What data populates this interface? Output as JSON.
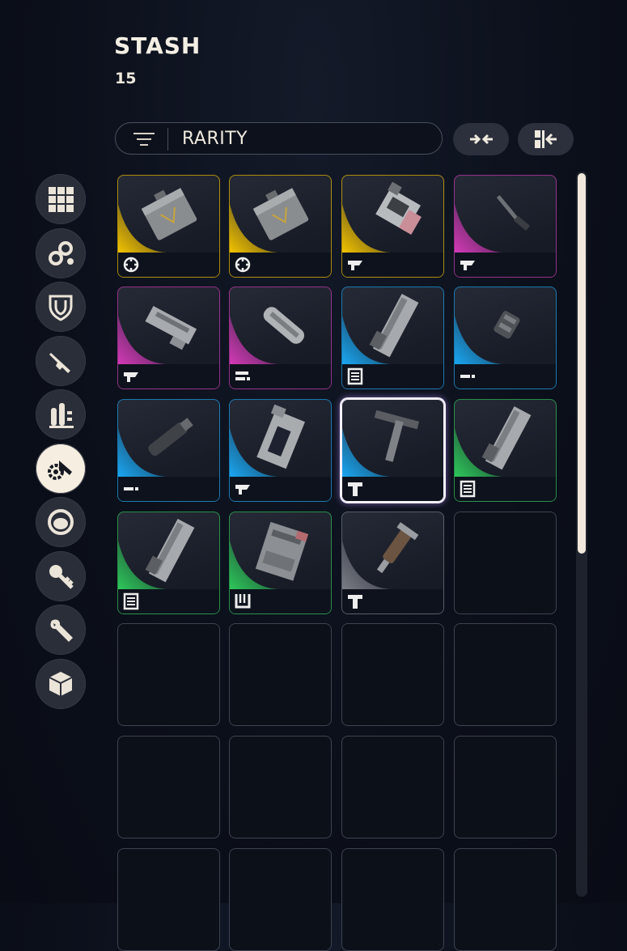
{
  "header": {
    "title": "STASH",
    "count": "15"
  },
  "filter": {
    "label": "RARITY",
    "icon": "filter-lines-icon"
  },
  "buttons": {
    "collapse": "collapse-arrows-icon",
    "sort": "sort-merge-icon"
  },
  "colors": {
    "legendary": "#f5c400",
    "epic": "#d43ab8",
    "rare": "#1aa7f2",
    "uncommon": "#2ec85a",
    "common": "#7a7d86",
    "active_category": "#f6eee0"
  },
  "categories": [
    {
      "icon": "grid-icon"
    },
    {
      "icon": "chain-icon"
    },
    {
      "icon": "shield-icon"
    },
    {
      "icon": "pistol-icon"
    },
    {
      "icon": "ammo-icon"
    },
    {
      "icon": "gear-gun-icon",
      "active": true
    },
    {
      "icon": "ring-icon"
    },
    {
      "icon": "key-icon"
    },
    {
      "icon": "wrench-icon"
    },
    {
      "icon": "cube-icon"
    }
  ],
  "slots": [
    {
      "rarity": "legendary",
      "type": "crosshair-icon",
      "item": "ammo-case"
    },
    {
      "rarity": "legendary",
      "type": "crosshair-icon",
      "item": "ammo-case"
    },
    {
      "rarity": "legendary",
      "type": "stock-icon",
      "item": "stock-block"
    },
    {
      "rarity": "epic",
      "type": "stock-icon",
      "item": "rod"
    },
    {
      "rarity": "epic",
      "type": "stock-icon",
      "item": "stock-frame"
    },
    {
      "rarity": "epic",
      "type": "underbarrel-icon",
      "item": "cylinder"
    },
    {
      "rarity": "rare",
      "type": "magazine-icon",
      "item": "long-mag"
    },
    {
      "rarity": "rare",
      "type": "muzzle-icon",
      "item": "muzzle"
    },
    {
      "rarity": "rare",
      "type": "muzzle-icon",
      "item": "silencer"
    },
    {
      "rarity": "rare",
      "type": "stock-icon",
      "item": "skeleton-stock"
    },
    {
      "rarity": "rare",
      "type": "tool-icon",
      "item": "t-tool",
      "selected": true
    },
    {
      "rarity": "uncommon",
      "type": "magazine-icon",
      "item": "long-mag"
    },
    {
      "rarity": "uncommon",
      "type": "magazine-icon",
      "item": "long-mag"
    },
    {
      "rarity": "uncommon",
      "type": "drum-icon",
      "item": "box-mag"
    },
    {
      "rarity": "common",
      "type": "tool-icon",
      "item": "grip-tool"
    },
    {
      "rarity": "empty"
    },
    {
      "rarity": "empty"
    },
    {
      "rarity": "empty"
    },
    {
      "rarity": "empty"
    },
    {
      "rarity": "empty"
    },
    {
      "rarity": "empty"
    },
    {
      "rarity": "empty"
    },
    {
      "rarity": "empty"
    },
    {
      "rarity": "empty"
    },
    {
      "rarity": "empty"
    },
    {
      "rarity": "empty"
    },
    {
      "rarity": "empty"
    },
    {
      "rarity": "empty"
    }
  ]
}
